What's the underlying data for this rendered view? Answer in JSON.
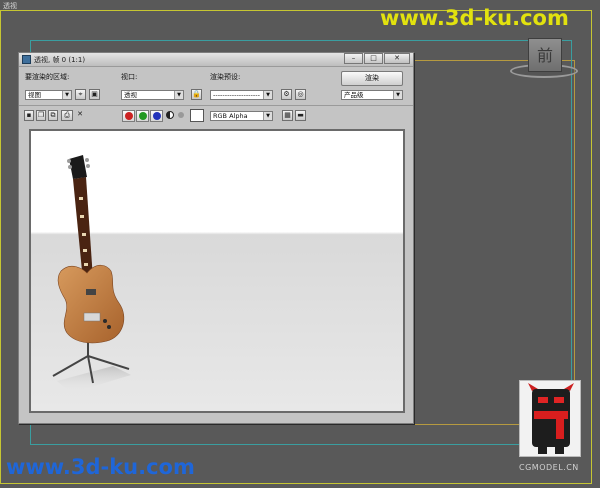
{
  "viewport": {
    "label": "透视",
    "cube_face": "前"
  },
  "watermark": {
    "top": "www.3d-ku.com",
    "bottom": "www.3d-ku.com"
  },
  "window": {
    "title": "透视, 帧 0 (1:1)",
    "controls": {
      "minimize": "–",
      "maximize": "□",
      "close": "✕"
    }
  },
  "toolbar": {
    "area_label": "要渲染的区域:",
    "area_value": "视图",
    "viewport_label": "视口:",
    "viewport_value": "透视",
    "preset_label": "渲染预设:",
    "preset_value": "--------------------",
    "render_button": "渲染",
    "product_value": "产品级",
    "channel_value": "RGB Alpha"
  },
  "colors": {
    "red": "#cc2222",
    "green": "#229922",
    "blue": "#2233bb",
    "mono": "#222222",
    "gray": "#999999"
  },
  "logo": {
    "text": "CGMODEL.CN"
  }
}
